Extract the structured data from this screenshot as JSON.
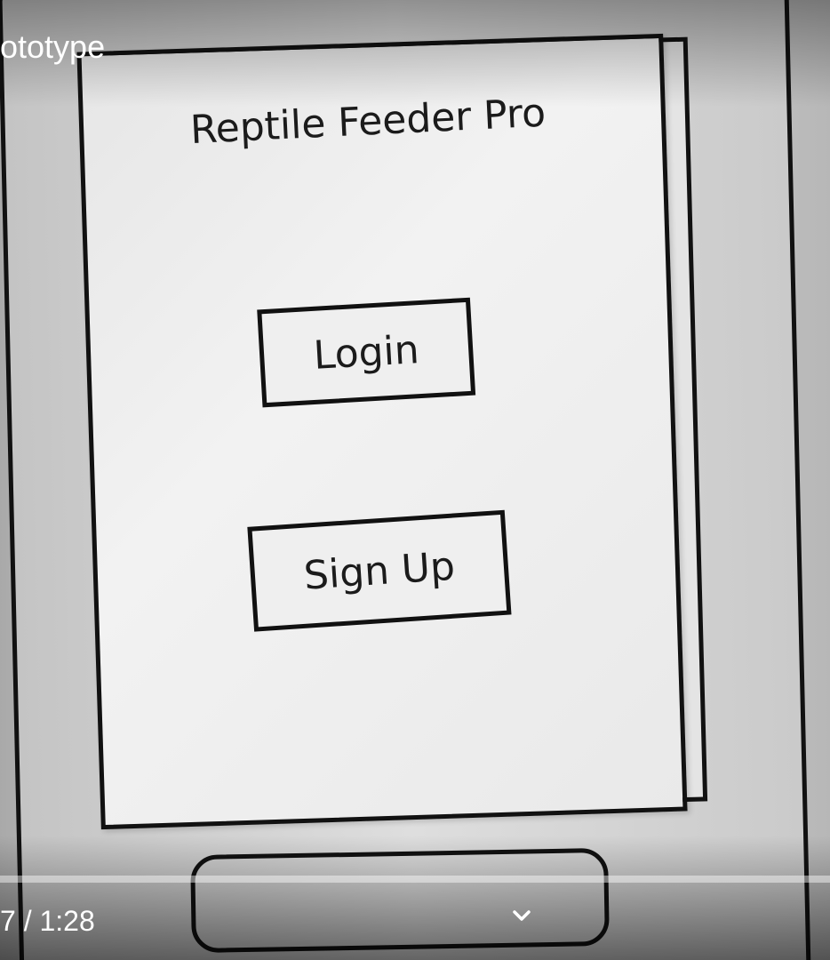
{
  "video": {
    "title": "ototype",
    "time": "7 / 1:28",
    "progress_fraction": 0,
    "progress_color": "#ff0000"
  },
  "sketch": {
    "app_title": "Reptile Feeder Pro",
    "buttons": {
      "login": "Login",
      "signup": "Sign Up"
    }
  },
  "icons": {
    "expand": "chevron-down-icon"
  }
}
